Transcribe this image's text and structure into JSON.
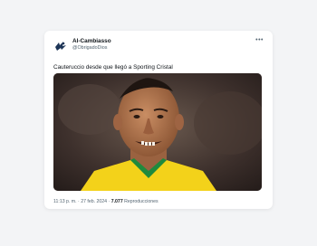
{
  "tweet": {
    "display_name": "Al-Cambiasso",
    "handle": "@ObrigadoDios",
    "more_icon": "more-options-icon",
    "text": "Cauteruccio desde que llegó a Sporting Cristal",
    "time": "11:13 p. m.",
    "separator": "·",
    "date": "27 feb. 2024",
    "views_count": "7.077",
    "views_label": "Reproducciones",
    "avatar_icon": "avatar-logo"
  }
}
